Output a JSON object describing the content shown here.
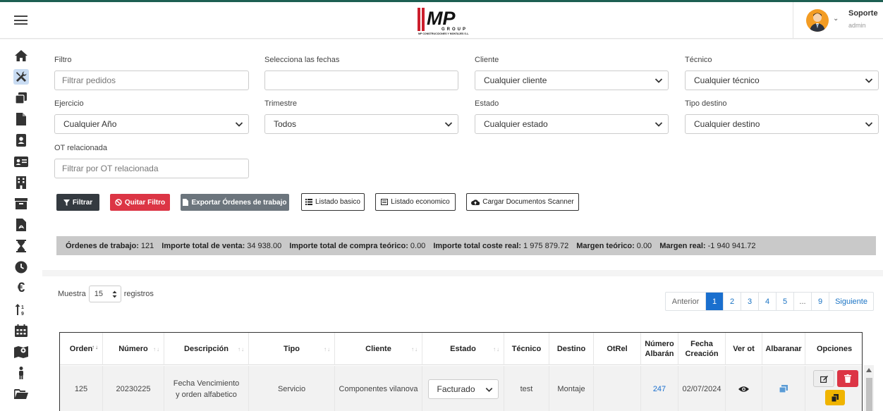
{
  "header": {
    "logo_text": "MP",
    "logo_sub": "GROUP",
    "logo_tagline": "MP CONSTRUCCIONES Y MONTAJES S.L.",
    "user_name": "Soporte",
    "user_role": "admin"
  },
  "sidebar": {
    "items": [
      "home-icon",
      "tools-icon",
      "copy-icon",
      "file-icon",
      "contact-icon",
      "id-card-icon",
      "building-icon",
      "archive-icon",
      "pdf-icon",
      "hourglass-icon",
      "clock-icon",
      "euro-icon",
      "sort-icon",
      "calendar-icon",
      "map-icon",
      "person-icon",
      "folder-icon"
    ],
    "active": "tools-icon"
  },
  "filters": {
    "filtro_label": "Filtro",
    "filtro_placeholder": "Filtrar pedidos",
    "fechas_label": "Selecciona las fechas",
    "fechas_value": "",
    "cliente_label": "Cliente",
    "cliente_value": "Cualquier cliente",
    "tecnico_label": "Técnico",
    "tecnico_value": "Cualquier técnico",
    "ejercicio_label": "Ejercicio",
    "ejercicio_value": "Cualquier Año",
    "trimestre_label": "Trimestre",
    "trimestre_value": "Todos",
    "estado_label": "Estado",
    "estado_value": "Cualquier estado",
    "destino_label": "Tipo destino",
    "destino_value": "Cualquier destino",
    "ot_label": "OT relacionada",
    "ot_placeholder": "Filtrar por OT relacionada"
  },
  "buttons": {
    "filtrar": "Filtrar",
    "quitar": "Quitar Filtro",
    "exportar": "Exportar Órdenes de trabajo",
    "basico": "Listado basico",
    "economico": "Listado economico",
    "scanner": "Cargar Documentos Scanner"
  },
  "summary": {
    "ordenes_label": "Órdenes de trabajo:",
    "ordenes_value": "121",
    "venta_label": "Importe total de venta:",
    "venta_value": "34 938.00",
    "compra_label": "Importe total de compra teórico:",
    "compra_value": "0.00",
    "coste_label": "Importe total coste real:",
    "coste_value": "1 975 879.72",
    "margen_teo_label": "Margen teórico:",
    "margen_teo_value": "0.00",
    "margen_real_label": "Margen real:",
    "margen_real_value": "-1 940 941.72"
  },
  "list": {
    "show_prefix": "Muestra",
    "show_value": "15",
    "show_suffix": "registros",
    "pagination": [
      "Anterior",
      "1",
      "2",
      "3",
      "4",
      "5",
      "...",
      "9",
      "Siguiente"
    ],
    "active_page": "1"
  },
  "table": {
    "headers": [
      "Orden",
      "Número",
      "Descripción",
      "Tipo",
      "Cliente",
      "Estado",
      "Técnico",
      "Destino",
      "OtRel",
      "Número Albarán",
      "Fecha Creación",
      "Ver ot",
      "Albaranar",
      "Opciones"
    ],
    "rows": [
      {
        "orden": "125",
        "numero": "20230225",
        "descripcion": "Fecha Vencimiento y orden alfabetico",
        "tipo": "Servicio",
        "cliente": "Componentes vilanova",
        "estado": "Facturado",
        "tecnico": "test",
        "destino": "Montaje",
        "otrel": "",
        "albaran": "247",
        "fecha": "02/07/2024"
      }
    ]
  },
  "colors": {
    "accent": "#1a6fce",
    "danger": "#dc3545",
    "warning": "#f0b400",
    "dark": "#343a40",
    "brand_red": "#cc1f2d"
  }
}
